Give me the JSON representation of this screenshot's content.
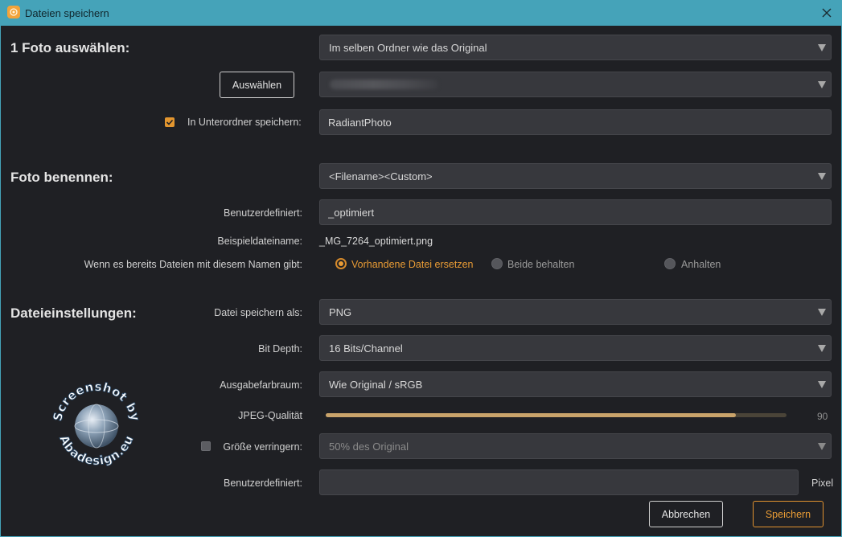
{
  "window": {
    "title": "Dateien speichern"
  },
  "colors": {
    "titlebar": "#45a3b9",
    "background": "#1f2024",
    "accent": "#e89b35",
    "field": "#37383d"
  },
  "icons": {
    "app": "radiant-photo-app-icon",
    "close": "close-icon",
    "dropdown": "chevron-down-icon",
    "checkbox_checked": "checkmark-icon"
  },
  "section_select": {
    "title": "1 Foto auswählen:",
    "folder_dropdown": "Im selben Ordner wie das Original",
    "choose_button": "Auswählen",
    "subfolder_checkbox_label": "In Unterordner speichern:",
    "subfolder_checked": true,
    "subfolder_value": "RadiantPhoto"
  },
  "section_name": {
    "title": "Foto benennen:",
    "pattern_dropdown": "<Filename><Custom>",
    "custom_label": "Benutzerdefiniert:",
    "custom_value": "_optimiert",
    "example_label": "Beispieldateiname:",
    "example_value": "_MG_7264_optimiert.png",
    "conflict_label": "Wenn es bereits Dateien mit diesem Namen gibt:",
    "conflict_options": [
      {
        "label": "Vorhandene Datei ersetzen",
        "selected": true
      },
      {
        "label": "Beide behalten",
        "selected": false
      },
      {
        "label": "Anhalten",
        "selected": false
      }
    ]
  },
  "section_file": {
    "title": "Dateieinstellungen:",
    "format_label": "Datei speichern als:",
    "format_value": "PNG",
    "bitdepth_label": "Bit Depth:",
    "bitdepth_value": "16 Bits/Channel",
    "colorspace_label": "Ausgabefarbraum:",
    "colorspace_value": "Wie Original / sRGB",
    "jpeg_label": "JPEG-Qualität",
    "jpeg_value": "90",
    "jpeg_fraction": 0.89,
    "resize_label": "Größe verringern:",
    "resize_checked": false,
    "resize_value": "50% des Original",
    "custom_size_label": "Benutzerdefiniert:",
    "custom_size_value": "",
    "unit": "Pixel"
  },
  "buttons": {
    "cancel": "Abbrechen",
    "save": "Speichern"
  },
  "watermark": {
    "top_text": "Screenshot by",
    "bottom_text": "Abadesign.eu"
  }
}
